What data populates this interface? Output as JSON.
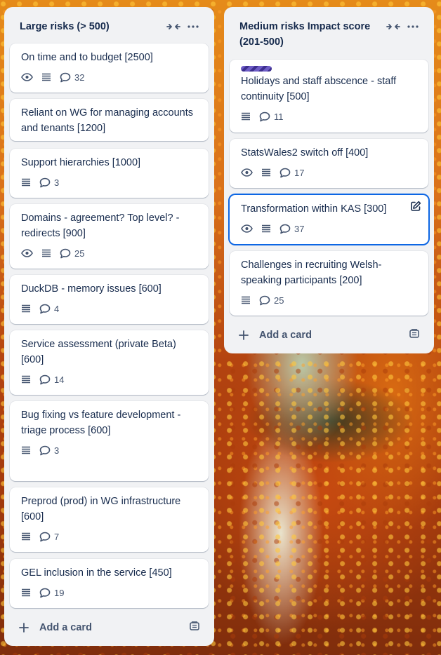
{
  "columns": [
    {
      "title": "Large risks (> 500)",
      "add_card_label": "Add a card",
      "cards": [
        {
          "title": "On time and to budget [2500]",
          "watch": true,
          "description": true,
          "comments": "32"
        },
        {
          "title": "Reliant on WG for managing accounts and tenants [1200]",
          "watch": false,
          "description": false,
          "comments": null
        },
        {
          "title": "Support hierarchies [1000]",
          "watch": false,
          "description": true,
          "comments": "3"
        },
        {
          "title": "Domains - agreement? Top level? - redirects [900]",
          "watch": true,
          "description": true,
          "comments": "25"
        },
        {
          "title": "DuckDB - memory issues [600]",
          "watch": false,
          "description": true,
          "comments": "4"
        },
        {
          "title": "Service assessment (private Beta) [600]",
          "watch": false,
          "description": true,
          "comments": "14"
        },
        {
          "title": "Bug fixing vs feature development - triage process [600]",
          "watch": false,
          "description": true,
          "comments": "3"
        },
        {
          "title": "Preprod (prod) in WG infrastructure [600]",
          "watch": false,
          "description": true,
          "comments": "7"
        },
        {
          "title": "GEL inclusion in the service [450]",
          "watch": false,
          "description": true,
          "comments": "19"
        }
      ]
    },
    {
      "title": "Medium risks Impact score (201-500)",
      "add_card_label": "Add a card",
      "cards": [
        {
          "title": "Holidays and staff abscence - staff continuity [500]",
          "label_color": "#6e5dc6",
          "watch": false,
          "description": true,
          "comments": "11"
        },
        {
          "title": "StatsWales2 switch off [400]",
          "watch": true,
          "description": true,
          "comments": "17"
        },
        {
          "title": "Transformation within KAS [300]",
          "watch": true,
          "description": true,
          "comments": "37",
          "focused": true
        },
        {
          "title": "Challenges in recruiting Welsh-speaking participants [200]",
          "watch": false,
          "description": true,
          "comments": "25"
        }
      ]
    }
  ],
  "colors": {
    "list_bg": "#f1f2f4",
    "card_bg": "#ffffff",
    "text": "#172b4d",
    "subtle_text": "#44546f",
    "focus_ring": "#0c66e4"
  },
  "icons": {
    "collapse": "collapse-arrows-icon",
    "more": "ellipsis-icon",
    "watch": "eye-icon",
    "description": "description-lines-icon",
    "comments": "comment-bubble-icon",
    "add": "plus-icon",
    "template": "card-template-icon",
    "edit": "pencil-edit-icon"
  }
}
